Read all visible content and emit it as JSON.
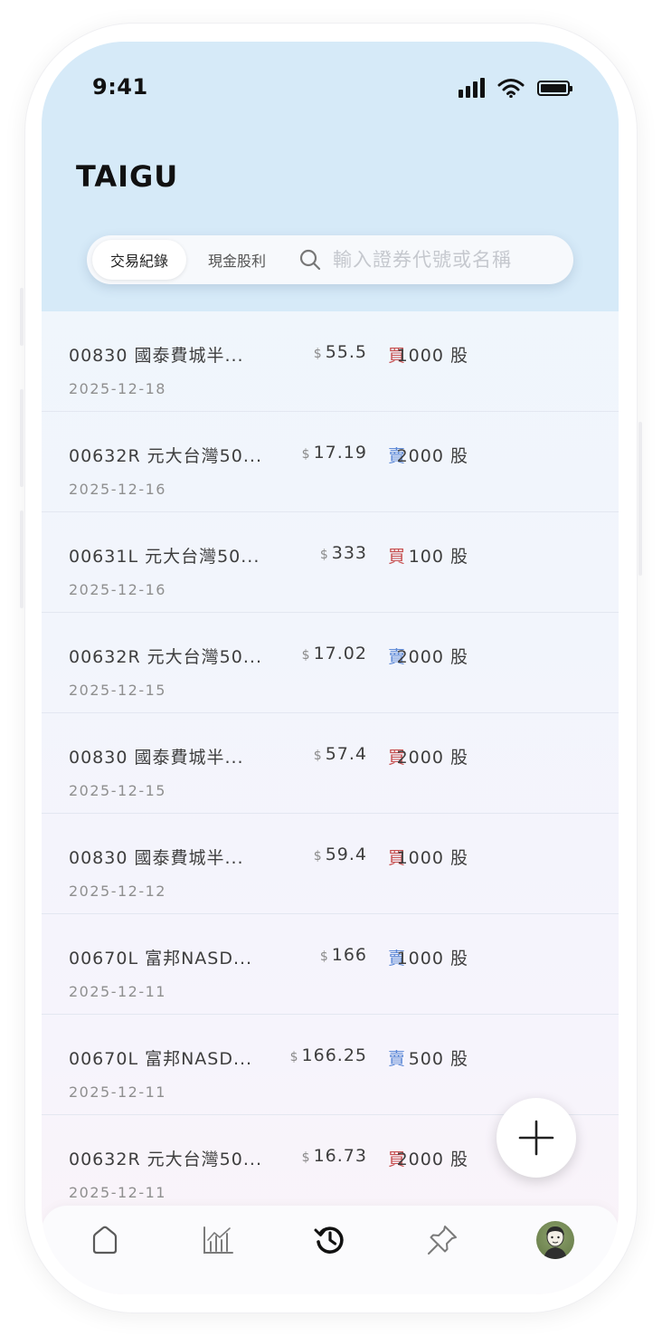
{
  "status_bar": {
    "time": "9:41"
  },
  "app": {
    "brand": "TAIGU"
  },
  "tabs": [
    {
      "label": "交易紀錄",
      "active": true
    },
    {
      "label": "現金股利",
      "active": false
    }
  ],
  "search": {
    "placeholder": "輸入證券代號或名稱",
    "value": ""
  },
  "colors": {
    "buy": "#c74f4f",
    "sell": "#5c88d6",
    "header_bg": "#d6eaf8"
  },
  "transactions": [
    {
      "name": "00830 國泰費城半...",
      "date": "2025-12-18",
      "currency": "$",
      "price": "55.5",
      "side": "買",
      "quantity": "1000 股"
    },
    {
      "name": "00632R 元大台灣50...",
      "date": "2025-12-16",
      "currency": "$",
      "price": "17.19",
      "side": "賣",
      "quantity": "2000 股"
    },
    {
      "name": "00631L 元大台灣50...",
      "date": "2025-12-16",
      "currency": "$",
      "price": "333",
      "side": "買",
      "quantity": "100 股"
    },
    {
      "name": "00632R 元大台灣50...",
      "date": "2025-12-15",
      "currency": "$",
      "price": "17.02",
      "side": "賣",
      "quantity": "2000 股"
    },
    {
      "name": "00830 國泰費城半...",
      "date": "2025-12-15",
      "currency": "$",
      "price": "57.4",
      "side": "買",
      "quantity": "2000 股"
    },
    {
      "name": "00830 國泰費城半...",
      "date": "2025-12-12",
      "currency": "$",
      "price": "59.4",
      "side": "買",
      "quantity": "1000 股"
    },
    {
      "name": "00670L 富邦NASD...",
      "date": "2025-12-11",
      "currency": "$",
      "price": "166",
      "side": "賣",
      "quantity": "1000 股"
    },
    {
      "name": "00670L 富邦NASD...",
      "date": "2025-12-11",
      "currency": "$",
      "price": "166.25",
      "side": "賣",
      "quantity": "500 股"
    },
    {
      "name": "00632R 元大台灣50...",
      "date": "2025-12-11",
      "currency": "$",
      "price": "16.73",
      "side": "買",
      "quantity": "2000 股"
    }
  ],
  "bottom_nav": [
    {
      "icon": "home-icon",
      "active": false
    },
    {
      "icon": "chart-icon",
      "active": false
    },
    {
      "icon": "history-icon",
      "active": true
    },
    {
      "icon": "pin-icon",
      "active": false
    },
    {
      "icon": "avatar",
      "active": false
    }
  ]
}
